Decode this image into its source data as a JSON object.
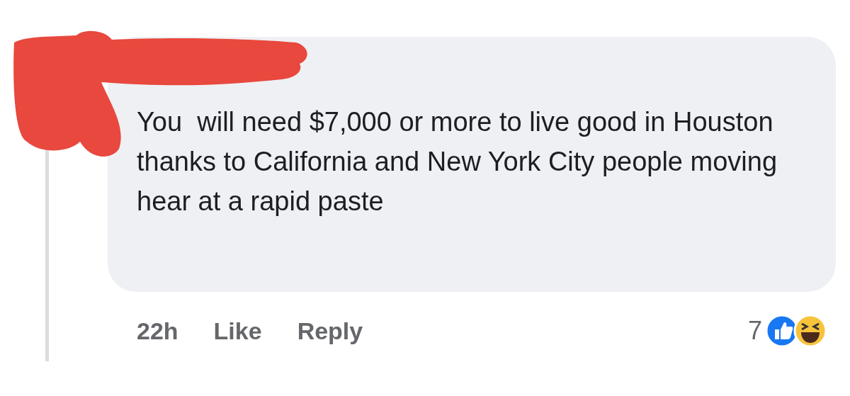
{
  "comment": {
    "text": "You  will need $7,000 or more to live good in Houston thanks to California and New York City people moving hear at a rapid paste",
    "time": "22h",
    "actions": [
      "Like",
      "Reply"
    ],
    "reaction_count": "7"
  }
}
